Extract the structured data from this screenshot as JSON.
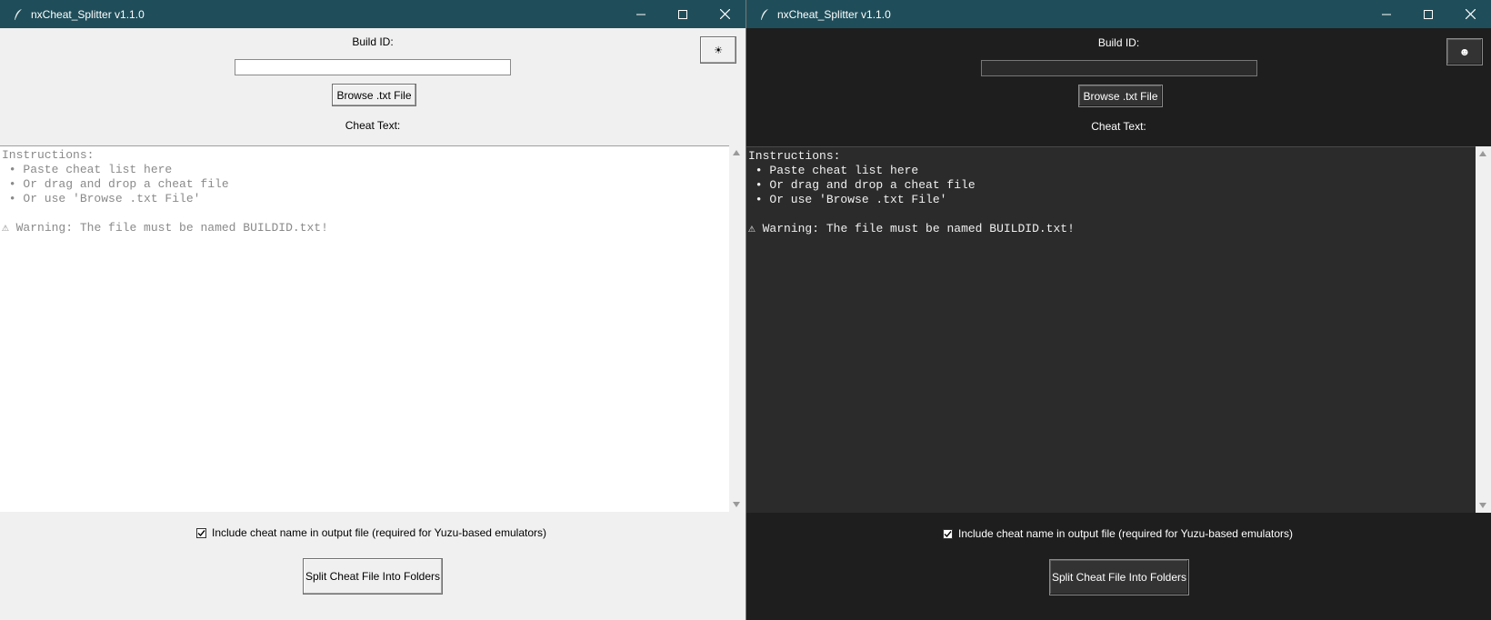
{
  "windows": [
    {
      "theme": "light",
      "title": "nxCheat_Splitter v1.1.0",
      "build_id_label": "Build ID:",
      "build_id_value": "",
      "browse_label": "Browse .txt File",
      "cheat_text_label": "Cheat Text:",
      "theme_toggle_icon": "sun-icon",
      "theme_toggle_glyph": "☀",
      "text_lines": [
        "Instructions:",
        " • Paste cheat list here",
        " • Or drag and drop a cheat file",
        " • Or use 'Browse .txt File'",
        "",
        "⚠ Warning: The file must be named BUILDID.txt!"
      ],
      "include_label": "Include cheat name in output file (required for Yuzu-based emulators)",
      "include_checked": true,
      "split_label": "Split Cheat File Into Folders"
    },
    {
      "theme": "dark",
      "title": "nxCheat_Splitter v1.1.0",
      "build_id_label": "Build ID:",
      "build_id_value": "",
      "browse_label": "Browse .txt File",
      "cheat_text_label": "Cheat Text:",
      "theme_toggle_icon": "moon-icon",
      "theme_toggle_glyph": "☻",
      "text_lines": [
        "Instructions:",
        " • Paste cheat list here",
        " • Or drag and drop a cheat file",
        " • Or use 'Browse .txt File'",
        "",
        "⚠ Warning: The file must be named BUILDID.txt!"
      ],
      "include_label": "Include cheat name in output file (required for Yuzu-based emulators)",
      "include_checked": true,
      "split_label": "Split Cheat File Into Folders"
    }
  ],
  "colors": {
    "titlebar_bg": "#1f4e5a",
    "light_bg": "#f0f0f0",
    "dark_bg": "#1e1e1e",
    "dark_text_area": "#2b2b2b",
    "placeholder_text": "#8a8a8a"
  }
}
